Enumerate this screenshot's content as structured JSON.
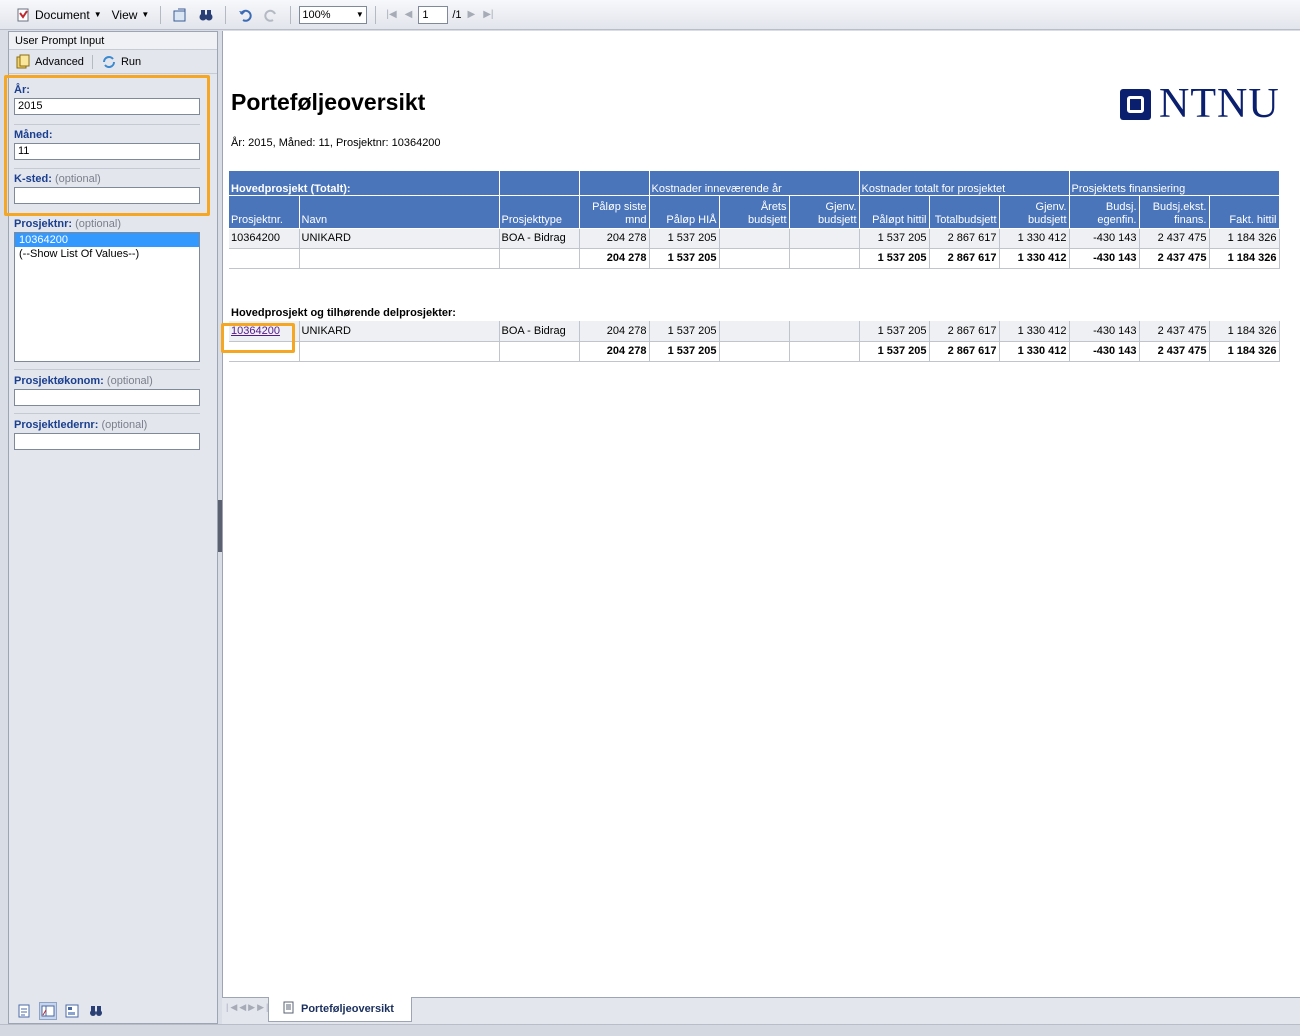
{
  "toolbar": {
    "document_label": "Document",
    "view_label": "View",
    "zoom_value": "100%",
    "page_value": "1",
    "page_total": "/1"
  },
  "left_panel": {
    "title": "User Prompt Input",
    "advanced_label": "Advanced",
    "run_label": "Run",
    "prompts": {
      "ar": {
        "label": "År:",
        "value": "2015"
      },
      "maned": {
        "label": "Måned:",
        "value": "11"
      },
      "ksted": {
        "label": "K-sted:",
        "optional": "(optional)",
        "value": ""
      },
      "prosjektnr": {
        "label": "Prosjektnr:",
        "optional": "(optional)",
        "options": [
          "10364200",
          "(--Show List Of Values--)"
        ]
      },
      "prosjektokonom": {
        "label": "Prosjektøkonom:",
        "optional": "(optional)",
        "value": ""
      },
      "prosjektledernr": {
        "label": "Prosjektledernr:",
        "optional": "(optional)",
        "value": ""
      }
    }
  },
  "report": {
    "title": "Porteføljeoversikt",
    "subtitle": "År: 2015, Måned: 11, Prosjektnr: 10364200",
    "logo_text": "NTNU",
    "table1": {
      "group_headers": [
        "Hovedprosjekt (Totalt):",
        "Kostnader inneværende år",
        "Kostnader totalt for prosjektet",
        "Prosjektets finansiering"
      ],
      "columns": [
        [
          "Prosjektnr."
        ],
        [
          "Navn"
        ],
        [
          "Prosjekttype"
        ],
        [
          "Påløp siste",
          "mnd"
        ],
        [
          "Påløp HIÅ"
        ],
        [
          "Årets",
          "budsjett"
        ],
        [
          "Gjenv.",
          "budsjett"
        ],
        [
          "Påløpt hittil"
        ],
        [
          "Totalbudsjett"
        ],
        [
          "Gjenv.",
          "budsjett"
        ],
        [
          "Budsj.",
          "egenfin."
        ],
        [
          "Budsj.ekst.",
          "finans."
        ],
        [
          "Fakt. hittil"
        ]
      ],
      "row": [
        "10364200",
        "UNIKARD",
        "BOA - Bidrag",
        "204 278",
        "1 537 205",
        "",
        "",
        "1 537 205",
        "2 867 617",
        "1 330 412",
        "-430 143",
        "2 437 475",
        "1 184 326"
      ],
      "total": [
        "",
        "",
        "",
        "204 278",
        "1 537 205",
        "",
        "",
        "1 537 205",
        "2 867 617",
        "1 330 412",
        "-430 143",
        "2 437 475",
        "1 184 326"
      ]
    },
    "section2_title": "Hovedprosjekt og  tilhørende delprosjekter:",
    "table2": {
      "row": [
        "10364200",
        "UNIKARD",
        "BOA - Bidrag",
        "204 278",
        "1 537 205",
        "",
        "",
        "1 537 205",
        "2 867 617",
        "1 330 412",
        "-430 143",
        "2 437 475",
        "1 184 326"
      ],
      "total": [
        "",
        "",
        "",
        "204 278",
        "1 537 205",
        "",
        "",
        "1 537 205",
        "2 867 617",
        "1 330 412",
        "-430 143",
        "2 437 475",
        "1 184 326"
      ]
    },
    "tab_label": "Porteføljeoversikt"
  },
  "colors": {
    "header_blue": "#4a75bb",
    "highlight_orange": "#f5a623",
    "logo_navy": "#0a1f6e"
  }
}
